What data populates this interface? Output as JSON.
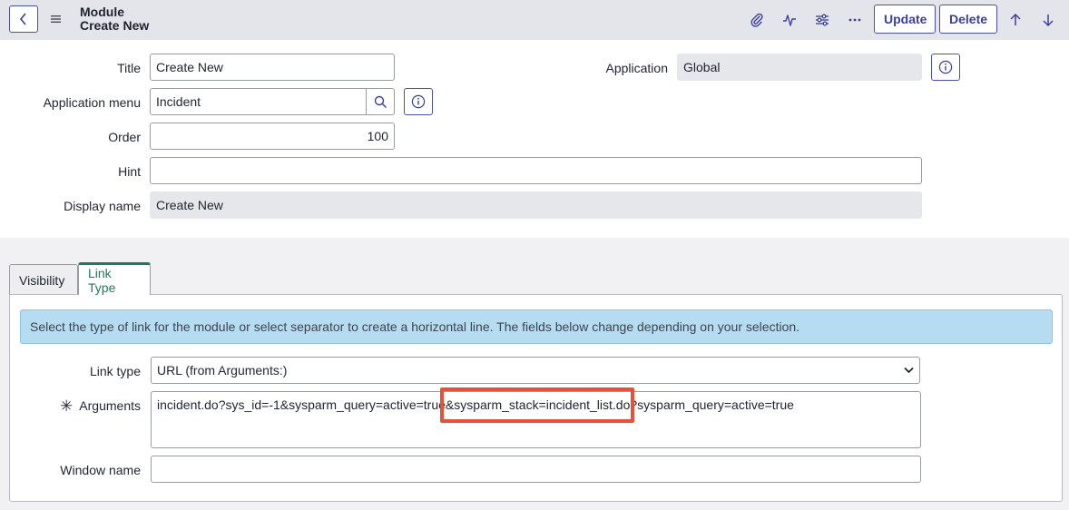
{
  "header": {
    "title_line1": "Module",
    "title_line2": "Create New",
    "icons": [
      "back-chevron-icon",
      "hamburger-menu-icon",
      "paperclip-icon",
      "activity-icon",
      "sliders-icon",
      "more-icon",
      "arrow-up-icon",
      "arrow-down-icon"
    ],
    "update_label": "Update",
    "delete_label": "Delete"
  },
  "form": {
    "title_label": "Title",
    "title_value": "Create New",
    "application_label": "Application",
    "application_value": "Global",
    "application_menu_label": "Application menu",
    "application_menu_value": "Incident",
    "order_label": "Order",
    "order_value": "100",
    "hint_label": "Hint",
    "hint_value": "",
    "display_name_label": "Display name",
    "display_name_value": "Create New"
  },
  "tabs": [
    {
      "label": "Visibility",
      "active": false
    },
    {
      "label": "Link Type",
      "active": true
    }
  ],
  "link_type": {
    "info_text": "Select the type of link for the module or select separator to create a horizontal line. The fields below change depending on your selection.",
    "link_type_label": "Link type",
    "link_type_value": "URL (from Arguments:)",
    "arguments_label": "Arguments",
    "arguments_required_mark": "✳",
    "arguments_value": "incident.do?sys_id=-1&sysparm_query=active=true&sysparm_stack=incident_list.do?sysparm_query=active=true",
    "window_name_label": "Window name",
    "window_name_value": ""
  },
  "colors": {
    "accent": "#4a4fb5",
    "active_tab": "#1e7a57",
    "info_banner": "#b6dcf2",
    "highlight": "#e8503a"
  }
}
